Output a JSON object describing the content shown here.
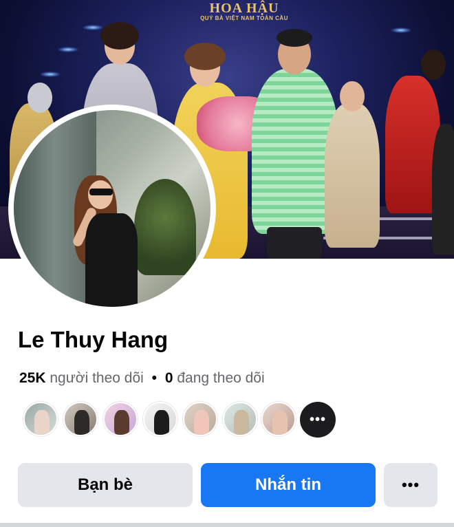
{
  "cover": {
    "banner_title": "HOA HẬU",
    "banner_subtitle": "QUÝ BÀ VIỆT NAM TOÀN CẦU"
  },
  "profile": {
    "name": "Le Thuy Hang",
    "followers_count": "25K",
    "followers_label": "người theo dõi",
    "separator": "•",
    "following_count": "0",
    "following_label": "đang theo dõi"
  },
  "friends": {
    "more_icon": "ellipsis-icon",
    "more_glyph": "•••"
  },
  "actions": {
    "friends_label": "Bạn bè",
    "message_label": "Nhắn tin",
    "more_glyph": "•••"
  },
  "colors": {
    "primary": "#1877f2",
    "secondary_button": "#e4e6eb",
    "text": "#050505",
    "muted_text": "#65676b"
  }
}
